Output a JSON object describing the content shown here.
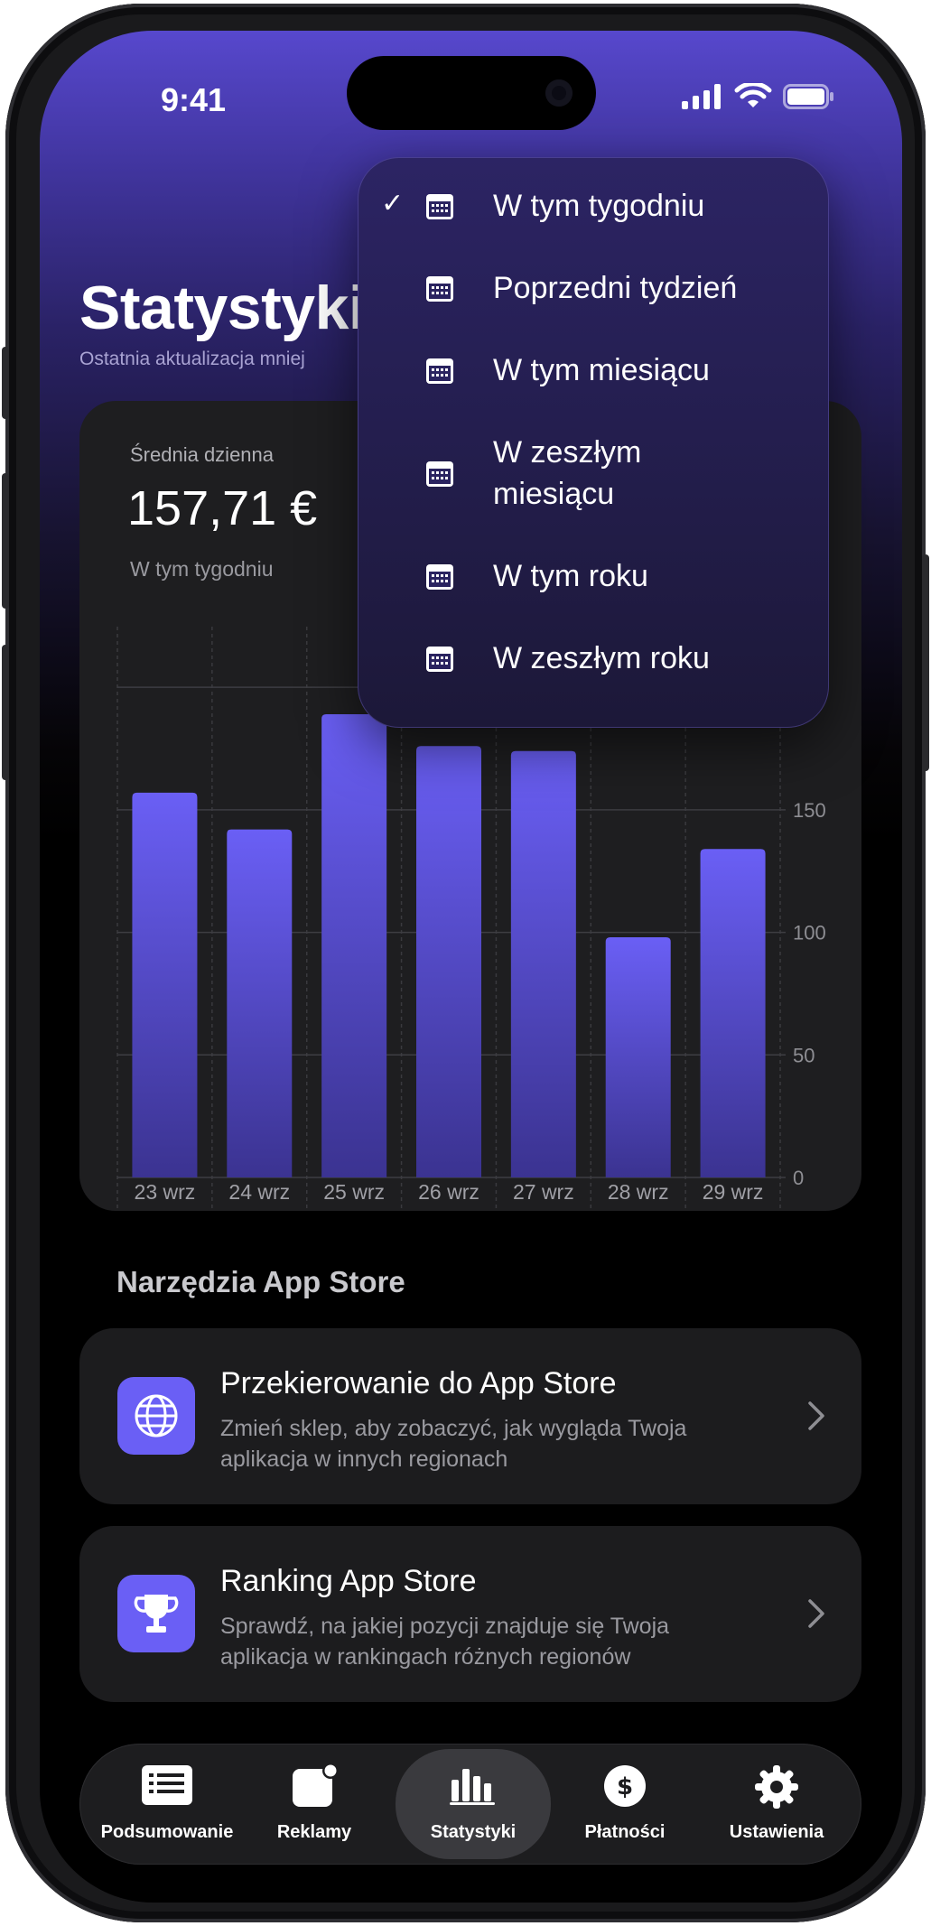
{
  "status_bar": {
    "time": "9:41"
  },
  "header": {
    "title": "Statystyki",
    "subtitle": "Ostatnia aktualizacja mniej"
  },
  "average": {
    "label": "Średnia dzienna",
    "value": "157,71 €",
    "period": "W tym tygodniu"
  },
  "period_menu": {
    "selected_index": 0,
    "items": [
      {
        "label": "W tym tygodniu"
      },
      {
        "label": "Poprzedni tydzień"
      },
      {
        "label": "W tym miesiącu"
      },
      {
        "label": "W zeszłym miesiącu"
      },
      {
        "label": "W tym roku"
      },
      {
        "label": "W zeszłym roku"
      }
    ]
  },
  "chart_data": {
    "type": "bar",
    "categories": [
      "23 wrz",
      "24 wrz",
      "25 wrz",
      "26 wrz",
      "27 wrz",
      "28 wrz",
      "29 wrz"
    ],
    "values": [
      157,
      142,
      189,
      176,
      174,
      98,
      134
    ],
    "y_ticks": [
      0,
      50,
      100,
      150
    ],
    "ylim": [
      0,
      224
    ],
    "bar_color": "#6a5ff5",
    "grid": true
  },
  "tools_section": {
    "title": "Narzędzia App Store",
    "cards": [
      {
        "title": "Przekierowanie do App Store",
        "description": "Zmień sklep, aby zobaczyć, jak wygląda Twoja aplikacja w innych regionach",
        "icon": "globe-icon"
      },
      {
        "title": "Ranking App Store",
        "description": "Sprawdź, na jakiej pozycji znajduje się Twoja aplikacja w rankingach różnych regionów",
        "icon": "trophy-icon"
      }
    ]
  },
  "tab_bar": {
    "active_index": 2,
    "tabs": [
      {
        "label": "Podsumowanie",
        "icon": "summary-list-icon"
      },
      {
        "label": "Reklamy",
        "icon": "ads-badge-icon"
      },
      {
        "label": "Statystyki",
        "icon": "bar-chart-icon"
      },
      {
        "label": "Płatności",
        "icon": "dollar-coin-icon"
      },
      {
        "label": "Ustawienia",
        "icon": "gear-icon"
      }
    ]
  },
  "colors": {
    "accent": "#6a5ff5",
    "header_gradient_top": "#5748cd",
    "background": "#000000",
    "card": "#1e1e20"
  }
}
